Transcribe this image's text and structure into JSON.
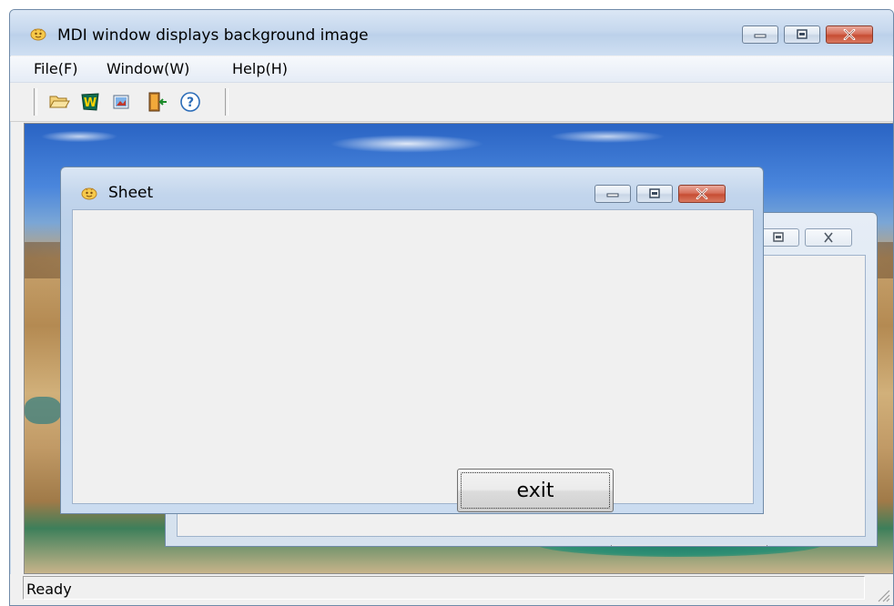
{
  "window": {
    "title": "MDI window displays background image",
    "controls": [
      "minimize",
      "maximize",
      "close"
    ]
  },
  "menu": {
    "items": [
      {
        "label": "File(F)"
      },
      {
        "label": "Window(W)"
      },
      {
        "label": "Help(H)"
      }
    ]
  },
  "toolbar": {
    "buttons": [
      {
        "icon": "open-folder-icon"
      },
      {
        "icon": "w-logo-icon"
      },
      {
        "icon": "picture-icon"
      },
      {
        "icon": "exit-door-icon"
      },
      {
        "icon": "help-icon"
      }
    ]
  },
  "child_front": {
    "title": "Sheet",
    "button_label": "exit"
  },
  "child_back": {
    "title": ""
  },
  "status": {
    "text": "Ready"
  },
  "colors": {
    "titlebar": "#c6d8ee",
    "close_button": "#c74d33",
    "client_frame": "#f0f0f0"
  }
}
